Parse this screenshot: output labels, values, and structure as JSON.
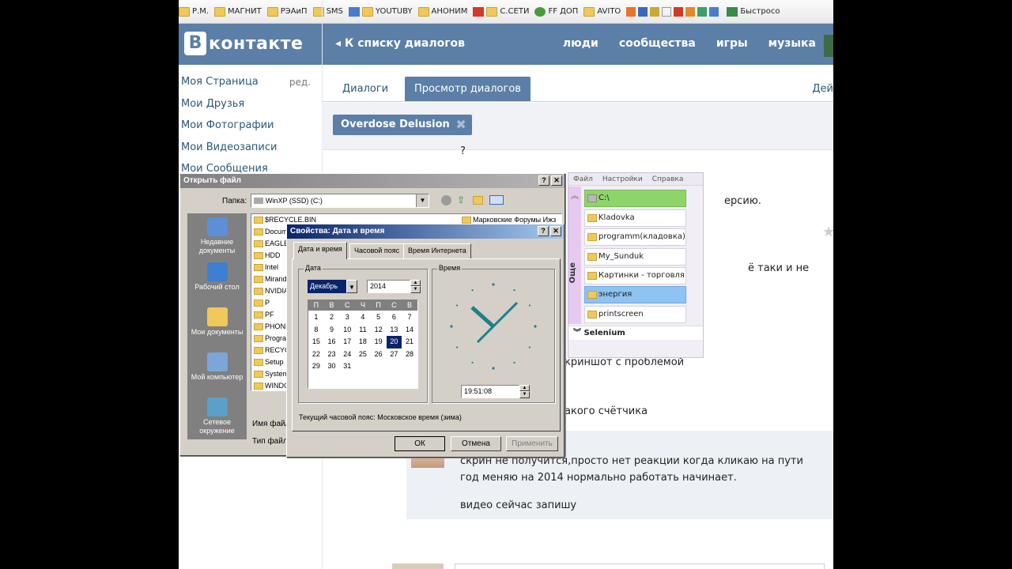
{
  "bookmarks": [
    "Р.М.",
    "МАГНИТ",
    "РЭАиП",
    "SMS",
    "YOUTUBY",
    "АНОНИМ",
    "С.СЕТИ",
    "FF ДОП",
    "AVITO",
    "Быстросо"
  ],
  "vk": {
    "logo_letter": "В",
    "logo_text": "контакте",
    "back_link": "◂  К списку диалогов",
    "nav": [
      "люди",
      "сообщества",
      "игры",
      "музыка"
    ],
    "left_menu": [
      "Моя Страница",
      "Мои Друзья",
      "Мои Фотографии",
      "Мои Видеозаписи",
      "Мои Сообщения"
    ],
    "edit_label": "ред.",
    "tabs": [
      "Диалоги",
      "Просмотр диалогов"
    ],
    "tab_actions": "Дей",
    "chat_user": "Overdose Delusion",
    "messages": {
      "q": "?",
      "m1": "ерсию.",
      "m2": "ё таки и не",
      "m3": "криншот с проблемой",
      "m4": "акого счётчика",
      "r1": "скрин не получится,просто нет реакции когда кликаю на пути",
      "r2": "год меняю на 2014 нормально работать начинает.",
      "r3": "видео сейчас запишу"
    }
  },
  "file_panel": {
    "menu": [
      "Файл",
      "Настройки",
      "Справка"
    ],
    "side_label": "Още",
    "items": [
      "C:\\",
      "Kladovka",
      "programm(кладовка)",
      "My_Sunduk",
      "Картинки - торговля",
      "энергия",
      "printscreen"
    ],
    "selenium_label": "Selenium"
  },
  "open_dialog": {
    "title": "Открыть файл",
    "folder_label": "Папка:",
    "folder_value": "WinXP (SSD) (C:)",
    "places": [
      "Недавние документы",
      "Рабочий стол",
      "Мои документы",
      "Мой компьютер",
      "Сетевое окружение"
    ],
    "files": [
      "$RECYCLE.BIN",
      "Docum",
      "EAGLE",
      "HDD",
      "Intel",
      "Mirand",
      "NVIDIA",
      "P",
      "PF",
      "PHONE",
      "Progra",
      "RECYC",
      "Setup",
      "System",
      "WINDO"
    ],
    "file_right": "Марковские Форумы Ижз",
    "filename_label": "Имя файл",
    "filetype_label": "Тип файл"
  },
  "datetime_dialog": {
    "title": "Свойства: Дата и время",
    "tabs": [
      "Дата и время",
      "Часовой пояс",
      "Время Интернета"
    ],
    "date_group": "Дата",
    "time_group": "Время",
    "month": "Декабрь",
    "year": "2014",
    "weekdays": [
      "П",
      "В",
      "С",
      "Ч",
      "П",
      "С",
      "В"
    ],
    "selected_day": "20",
    "days": [
      "1",
      "2",
      "3",
      "4",
      "5",
      "6",
      "7",
      "8",
      "9",
      "10",
      "11",
      "12",
      "13",
      "14",
      "15",
      "16",
      "17",
      "18",
      "19",
      "20",
      "21",
      "22",
      "23",
      "24",
      "25",
      "26",
      "27",
      "28",
      "29",
      "30",
      "31"
    ],
    "time_value": "19:51:08",
    "timezone_text": "Текущий часовой пояс: Московское время (зима)",
    "ok": "ОК",
    "cancel": "Отмена",
    "apply": "Применить"
  }
}
